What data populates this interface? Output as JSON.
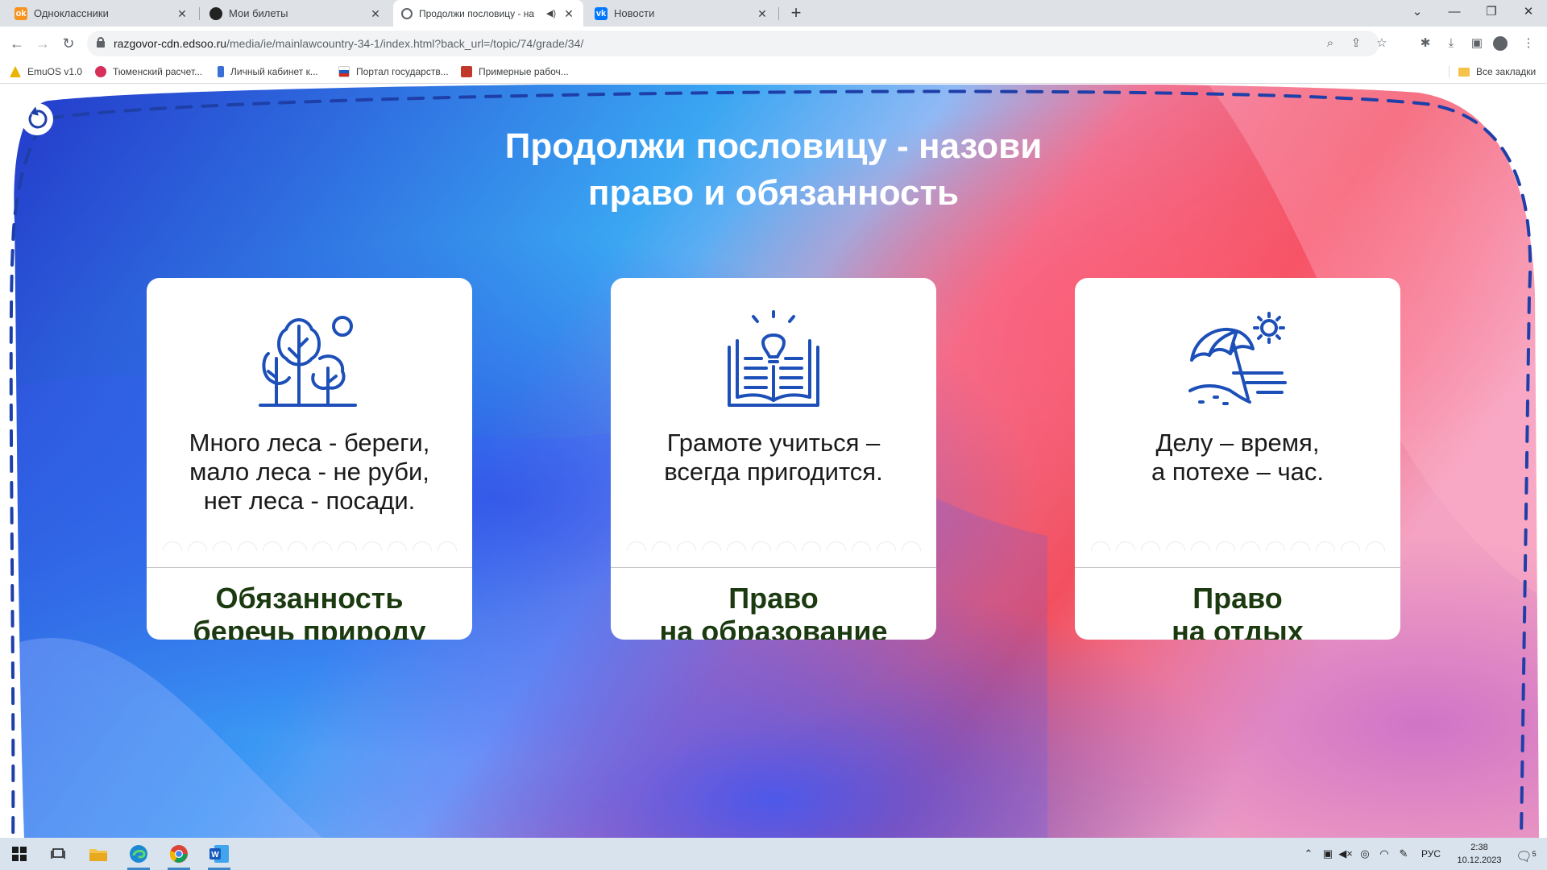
{
  "browser": {
    "tabs": [
      {
        "title": "Одноклассники",
        "favicon": "ok-icon",
        "color": "#f7931e",
        "active": false
      },
      {
        "title": "Мои билеты",
        "favicon": "ticket-icon",
        "color": "#222222",
        "active": false
      },
      {
        "title": "Продолжи пословицу - на",
        "favicon": "globe-icon",
        "color": "#5f6368",
        "active": true
      },
      {
        "title": "Новости",
        "favicon": "vk-icon",
        "color": "#0077ff",
        "active": false
      }
    ],
    "url_host": "razgovor-cdn.edsoo.ru",
    "url_path": "/media/ie/mainlawcountry-34-1/index.html?back_url=/topic/74/grade/34/",
    "bookmarks": [
      {
        "label": "EmuOS v1.0",
        "color": "#e8b400"
      },
      {
        "label": "Тюменский расчет...",
        "color": "#d6305a"
      },
      {
        "label": "Личный кабинет к...",
        "color": "#3a6fd8"
      },
      {
        "label": "Портал государств...",
        "color": "#1d5bbf"
      },
      {
        "label": "Примерные рабоч...",
        "color": "#c0392b"
      }
    ],
    "all_bookmarks": "Все закладки"
  },
  "page": {
    "title": "Продолжи пословицу - назови право и обязанность",
    "title_line1": "Продолжи пословицу - назови",
    "title_line2": "право и обязанность",
    "cards": [
      {
        "icon": "trees-icon",
        "proverb_lines": [
          "Много леса - береги,",
          "мало леса - не руби,",
          "нет леса - посади."
        ],
        "answer_lines": [
          "Обязанность",
          "беречь природу"
        ]
      },
      {
        "icon": "book-lightbulb-icon",
        "proverb_lines": [
          "Грамоте учиться –",
          "всегда пригодится."
        ],
        "answer_lines": [
          "Право",
          "на образование"
        ]
      },
      {
        "icon": "beach-umbrella-icon",
        "proverb_lines": [
          "Делу – время,",
          "а потехе – час."
        ],
        "answer_lines": [
          "Право",
          "на отдых"
        ]
      }
    ]
  },
  "taskbar": {
    "lang": "РУС",
    "time": "2:38",
    "date": "10.12.2023",
    "notifications": "5"
  },
  "colors": {
    "accent_blue": "#1a3fc4",
    "dash_border": "#1f3fa8",
    "icon_blue": "#1d4fb8",
    "answer_text": "#1b3a10"
  }
}
